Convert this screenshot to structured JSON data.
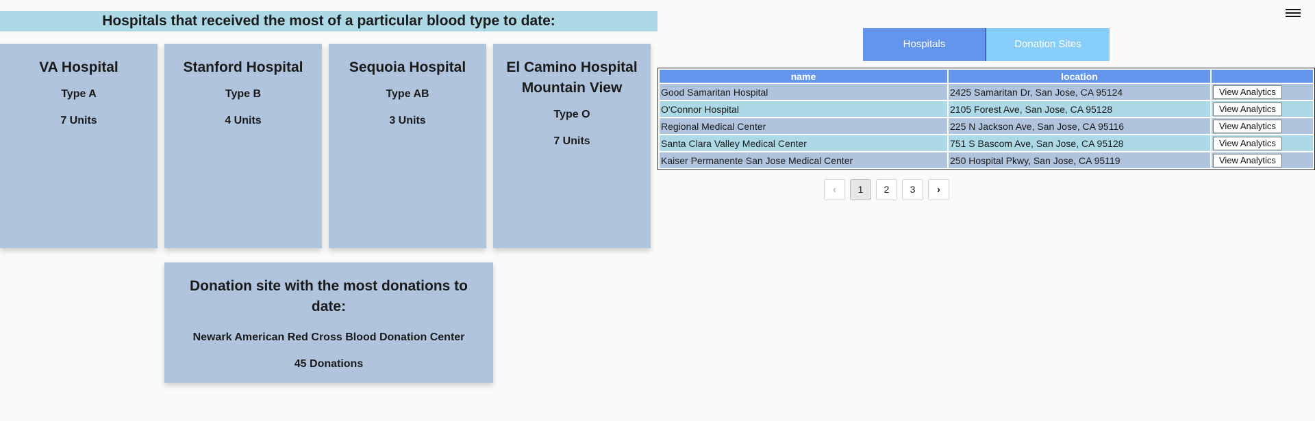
{
  "banner": {
    "title": "Hospitals that received the most of a particular blood type to date:"
  },
  "blood_cards": [
    {
      "hospital": "VA Hospital",
      "type": "Type A",
      "units": "7 Units"
    },
    {
      "hospital": "Stanford Hospital",
      "type": "Type B",
      "units": "4 Units"
    },
    {
      "hospital": "Sequoia Hospital",
      "type": "Type AB",
      "units": "3 Units"
    },
    {
      "hospital": "El Camino Hospital Mountain View",
      "type": "Type O",
      "units": "7 Units"
    }
  ],
  "donation_site_card": {
    "title": "Donation site with the most donations to date:",
    "site": "Newark American Red Cross Blood Donation Center",
    "count": "45 Donations"
  },
  "tabs": [
    {
      "label": "Hospitals",
      "active": true
    },
    {
      "label": "Donation Sites",
      "active": false
    }
  ],
  "table": {
    "headers": [
      "name",
      "location",
      ""
    ],
    "rows": [
      {
        "name": "Good Samaritan Hospital",
        "location": "2425 Samaritan Dr, San Jose, CA 95124",
        "action": "View Analytics"
      },
      {
        "name": "O'Connor Hospital",
        "location": "2105 Forest Ave, San Jose, CA 95128",
        "action": "View Analytics"
      },
      {
        "name": "Regional Medical Center",
        "location": "225 N Jackson Ave, San Jose, CA 95116",
        "action": "View Analytics"
      },
      {
        "name": "Santa Clara Valley Medical Center",
        "location": "751 S Bascom Ave, San Jose, CA 95128",
        "action": "View Analytics"
      },
      {
        "name": "Kaiser Permanente San Jose Medical Center",
        "location": "250 Hospital Pkwy, San Jose, CA 95119",
        "action": "View Analytics"
      }
    ]
  },
  "pagination": {
    "prev": "‹",
    "pages": [
      "1",
      "2",
      "3"
    ],
    "current": "1",
    "next": "›"
  },
  "icons": {
    "menu": "hamburger-menu-icon"
  },
  "colors": {
    "card_bg": "#b0c4de",
    "banner_bg": "#add8e6",
    "tab_active": "#6495ed",
    "tab_inactive": "#87cefa"
  }
}
